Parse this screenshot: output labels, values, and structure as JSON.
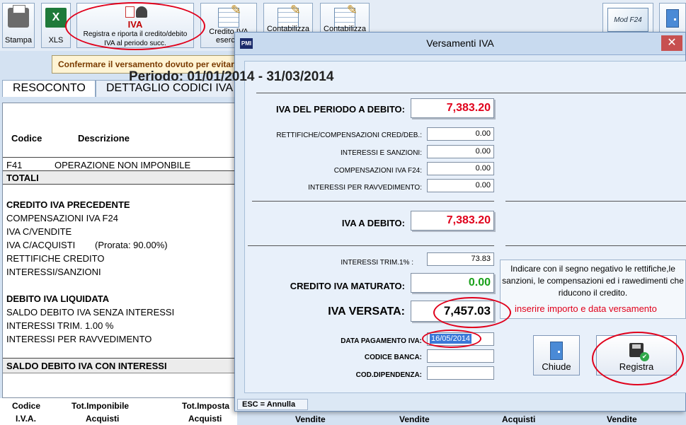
{
  "toolbar": {
    "stampa": "Stampa",
    "xls": "XLS",
    "xls_icon": "X",
    "iva_title": "IVA",
    "iva_desc_1": "Registra e riporta il credito/debito",
    "iva_desc_2": "IVA al periodo succ.",
    "credito_iva": "Credito IVA",
    "credito_iva_2": "eserc.p",
    "contabilizza_1": "Contabilizza",
    "contabilizza_2": "Contabilizza",
    "f24": "Mod F24"
  },
  "notice": "Confermare il versamento dovuto per evitare",
  "tabs": {
    "resoconto": "RESOCONTO",
    "dettaglio": "DETTAGLIO CODICI IVA"
  },
  "report": {
    "col_codice": "Codice",
    "col_descrizione": "Descrizione",
    "row_code": "F41",
    "row_desc": "OPERAZIONE NON IMPONBILE",
    "totali": "TOTALI",
    "credito_precedente": "CREDITO IVA PRECEDENTE",
    "compensazioni": "COMPENSAZIONI IVA F24",
    "iva_vendite": "IVA C/VENDITE",
    "iva_acquisti": "IVA C/ACQUISTI",
    "prorata": "(Prorata: 90.00%)",
    "rettifiche": "RETTIFICHE CREDITO",
    "interessi_sanzioni": "INTERESSI/SANZIONI",
    "debito_liquidata": "DEBITO IVA LIQUIDATA",
    "saldo_senza": "SALDO DEBITO IVA SENZA INTERESSI",
    "interessi_trim": "INTERESSI TRIM. 1.00  %",
    "interessi_ravv": "INTERESSI PER RAVVEDIMENTO",
    "saldo_con": "SALDO DEBITO IVA CON INTERESSI"
  },
  "footer": {
    "h_codice": "Codice",
    "h_iva": "I.V.A.",
    "h_tot_imponibile": "Tot.Imponibile",
    "h_acquisti_1": "Acquisti",
    "h_tot_imposta": "Tot.Imposta",
    "h_acquisti_2": "Acquisti",
    "h_vendite_1": "Vendite",
    "h_vendite_2": "Vendite",
    "h_acquisti_3": "Acquisti",
    "h_vendite_3": "Vendite"
  },
  "dialog": {
    "logo": "PMI",
    "title": "Versamenti IVA",
    "close": "✕",
    "periodo": "Periodo: 01/01/2014 - 31/03/2014",
    "iva_periodo_label": "IVA DEL PERIODO A DEBITO:",
    "iva_periodo_value": "7,383.20",
    "rettifiche_label": "RETTIFICHE/COMPENSAZIONI CRED/DEB.:",
    "rettifiche_value": "0.00",
    "interessi_sanzioni_label": "INTERESSI E SANZIONI:",
    "interessi_sanzioni_value": "0.00",
    "compensazioni_label": "COMPENSAZIONI IVA F24:",
    "compensazioni_value": "0.00",
    "ravvedimento_label": "INTERESSI PER RAVVEDIMENTO:",
    "ravvedimento_value": "0.00",
    "iva_debito_label": "IVA A DEBITO:",
    "iva_debito_value": "7,383.20",
    "interessi_trim_label": "INTERESSI TRIM.1%   :",
    "interessi_trim_value": "73.83",
    "credito_label": "CREDITO IVA MATURATO:",
    "credito_value": "0.00",
    "versata_label": "IVA VERSATA:",
    "versata_value": "7,457.03",
    "data_label": "DATA PAGAMENTO IVA:",
    "data_value": "16/05/2014",
    "banca_label": "CODICE BANCA:",
    "banca_value": "",
    "dipendenza_label": "COD.DIPENDENZA:",
    "dipendenza_value": "",
    "info": "Indicare con il segno negativo le rettifiche,le sanzioni, le compensazioni ed i rawedimenti che riducono il credito.",
    "hint": "inserire importo e data versamento",
    "chiude": "Chiude",
    "registra": "Registra",
    "status": "ESC = Annulla"
  },
  "colors": {
    "accent_red": "#e0001b",
    "value_green": "#1aa01a",
    "title_bar": "#c8daef"
  }
}
